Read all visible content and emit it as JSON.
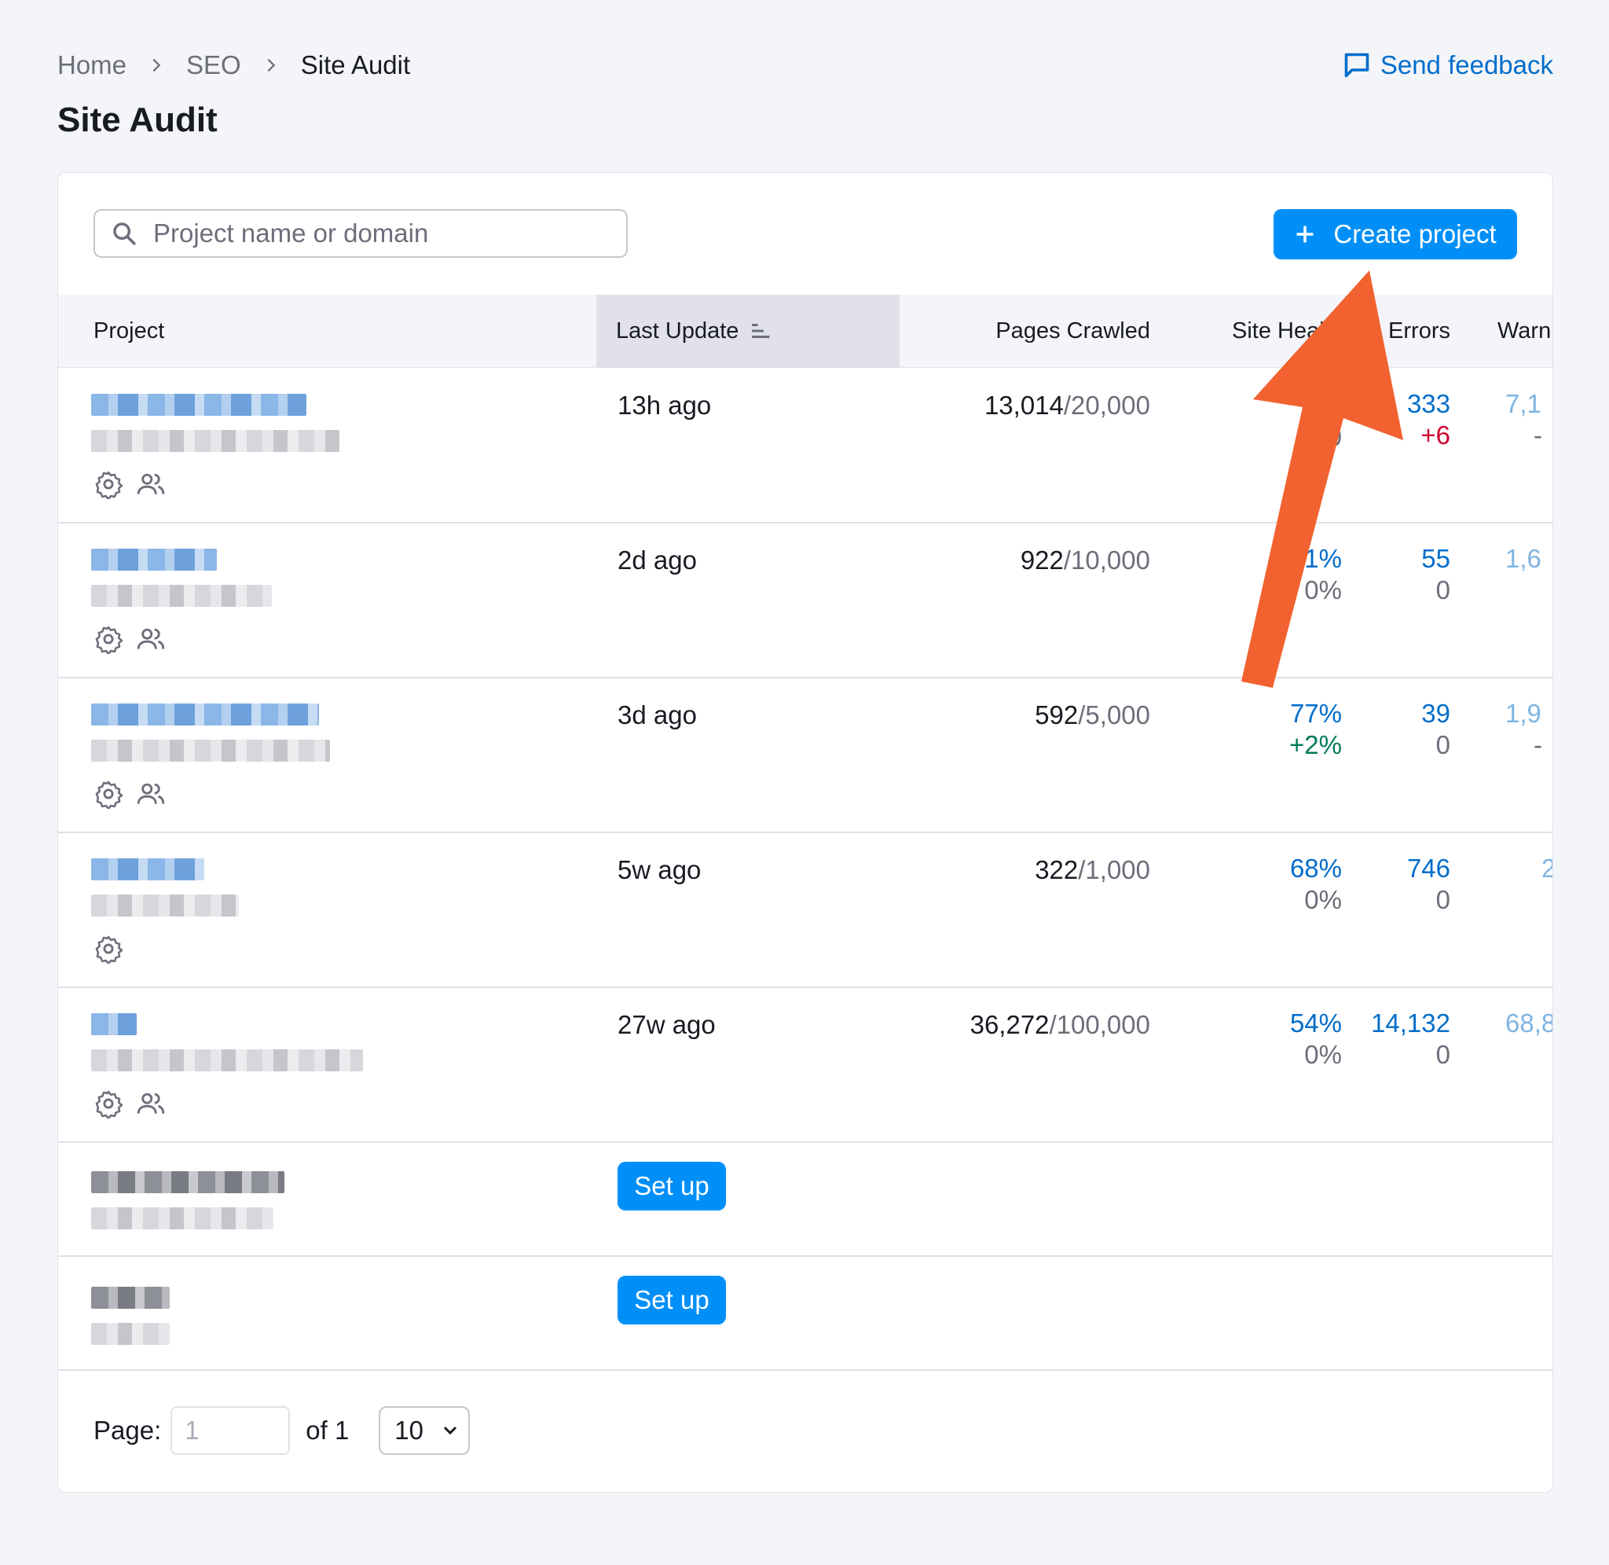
{
  "breadcrumb": {
    "home": "Home",
    "seo": "SEO",
    "current": "Site Audit"
  },
  "feedback": {
    "label": "Send feedback"
  },
  "page": {
    "title": "Site Audit"
  },
  "search": {
    "placeholder": "Project name or domain"
  },
  "create": {
    "label": "Create project"
  },
  "table": {
    "headers": {
      "project": "Project",
      "last_update": "Last Update",
      "pages_crawled": "Pages Crawled",
      "site_health": "Site Health",
      "errors": "Errors",
      "warnings": "Warnings"
    },
    "rows": [
      {
        "last_update": "13h ago",
        "pages_crawled": "13,014",
        "pages_limit": "/20,000",
        "health_sub": "0",
        "errors": "333",
        "errors_delta": "+6",
        "warnings": "7,1",
        "warnings_sub": "-"
      },
      {
        "last_update": "2d ago",
        "pages_crawled": "922",
        "pages_limit": "/10,000",
        "health": "1%",
        "health_delta": "0%",
        "errors": "55",
        "errors_delta": "0",
        "warnings": "1,6"
      },
      {
        "last_update": "3d ago",
        "pages_crawled": "592",
        "pages_limit": "/5,000",
        "health": "77%",
        "health_delta": "+2%",
        "errors": "39",
        "errors_delta": "0",
        "warnings": "1,9",
        "warnings_sub": "-"
      },
      {
        "last_update": "5w ago",
        "pages_crawled": "322",
        "pages_limit": "/1,000",
        "health": "68%",
        "health_delta": "0%",
        "errors": "746",
        "errors_delta": "0",
        "warnings": "2"
      },
      {
        "last_update": "27w ago",
        "pages_crawled": "36,272",
        "pages_limit": "/100,000",
        "health": "54%",
        "health_delta": "0%",
        "errors": "14,132",
        "errors_delta": "0",
        "warnings": "68,8"
      },
      {
        "setup_label": "Set up"
      },
      {
        "setup_label": "Set up"
      }
    ]
  },
  "pagination": {
    "page_label": "Page:",
    "page_value": "1",
    "of_label": "of 1",
    "per_page": "10"
  },
  "colors": {
    "accent": "#008ff8",
    "link": "#006dca",
    "positive": "#007a5a",
    "negative": "#d1002f",
    "annotation_arrow": "#f26230"
  },
  "icons": [
    "chevron-right-icon",
    "feedback-icon",
    "search-icon",
    "plus-icon",
    "sort-icon",
    "gear-icon",
    "users-icon",
    "chevron-down-icon"
  ]
}
